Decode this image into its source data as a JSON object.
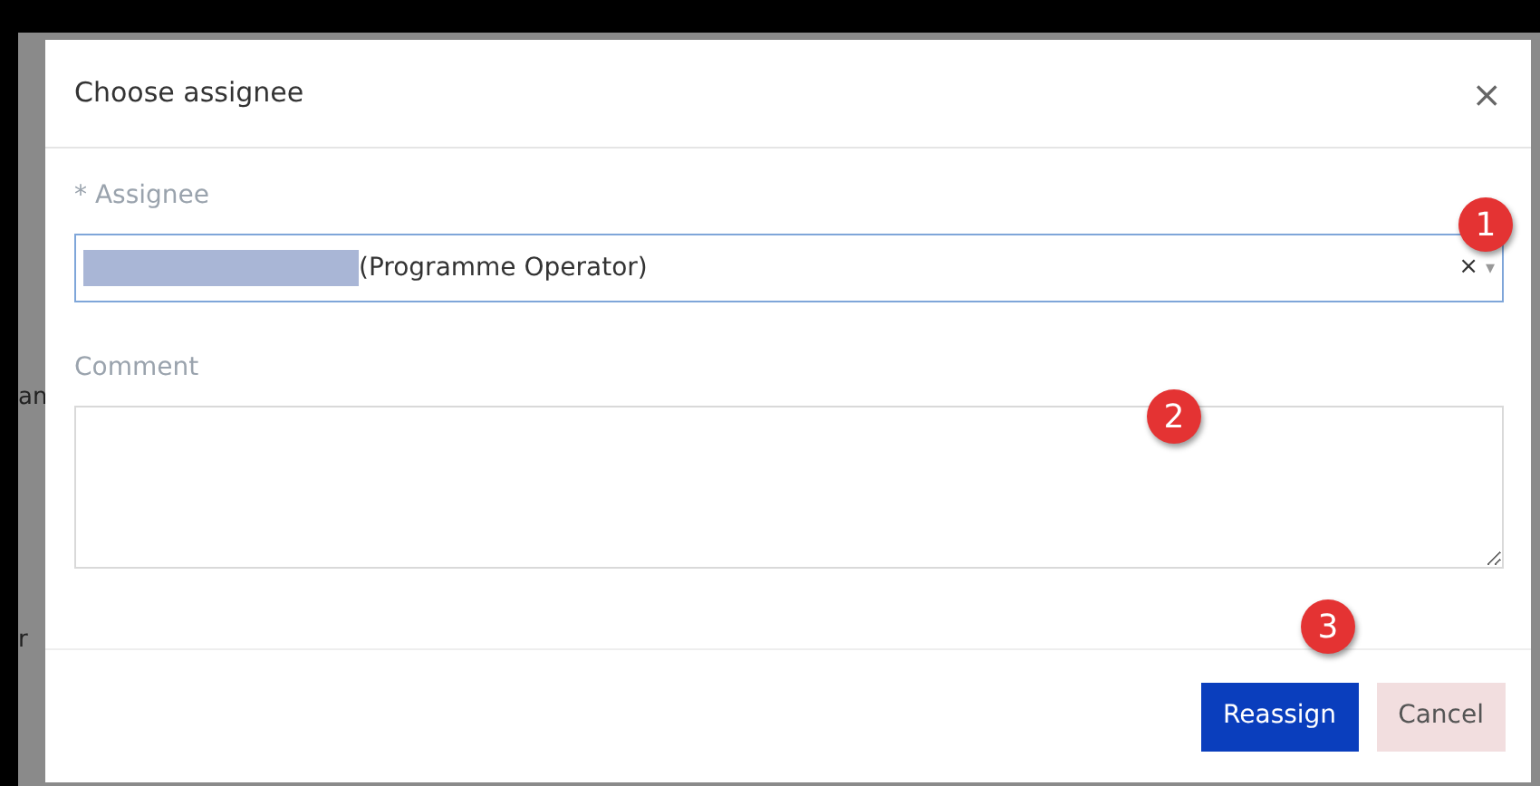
{
  "backdrop": {
    "fragments": [
      {
        "text": "an"
      },
      {
        "text": "r"
      }
    ]
  },
  "dialog": {
    "title": "Choose assignee",
    "close": "×",
    "assignee": {
      "label": "* Assignee",
      "value": "(Programme Operator)",
      "redacted": true,
      "clear": "×",
      "caret": "▾"
    },
    "comment": {
      "label": "Comment"
    },
    "buttons": [
      {
        "label": "Reassign",
        "kind": "primary"
      },
      {
        "label": "Cancel",
        "kind": "secondary"
      }
    ]
  },
  "annotations": [
    {
      "label": "1"
    },
    {
      "label": "2"
    },
    {
      "label": "3"
    }
  ]
}
